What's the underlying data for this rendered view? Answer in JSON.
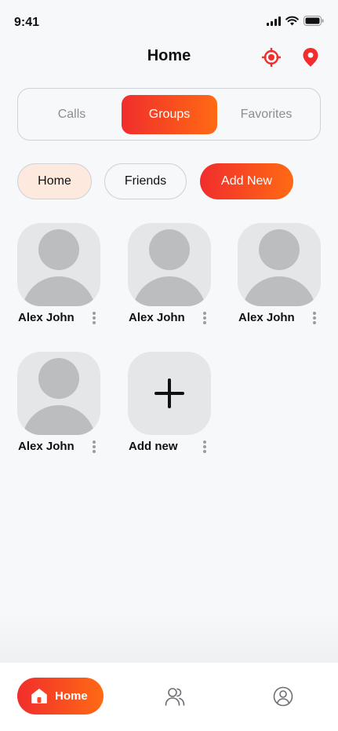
{
  "status_bar": {
    "time": "9:41"
  },
  "header": {
    "title": "Home"
  },
  "tabs": [
    {
      "label": "Calls",
      "active": false
    },
    {
      "label": "Groups",
      "active": true
    },
    {
      "label": "Favorites",
      "active": false
    }
  ],
  "chips": {
    "home": "Home",
    "friends": "Friends",
    "add_new": "Add New"
  },
  "contacts": [
    {
      "name": "Alex John"
    },
    {
      "name": "Alex John"
    },
    {
      "name": "Alex John"
    },
    {
      "name": "Alex John"
    },
    {
      "name": "Add new"
    }
  ],
  "bottom_nav": {
    "home_label": "Home"
  },
  "colors": {
    "accent_start": "#f12d2d",
    "accent_end": "#ff6a14",
    "icon_red": "#f12d2d"
  },
  "icons": [
    "crosshair-icon",
    "location-pin-icon",
    "plus-icon",
    "home-icon",
    "contacts-icon",
    "profile-icon"
  ]
}
